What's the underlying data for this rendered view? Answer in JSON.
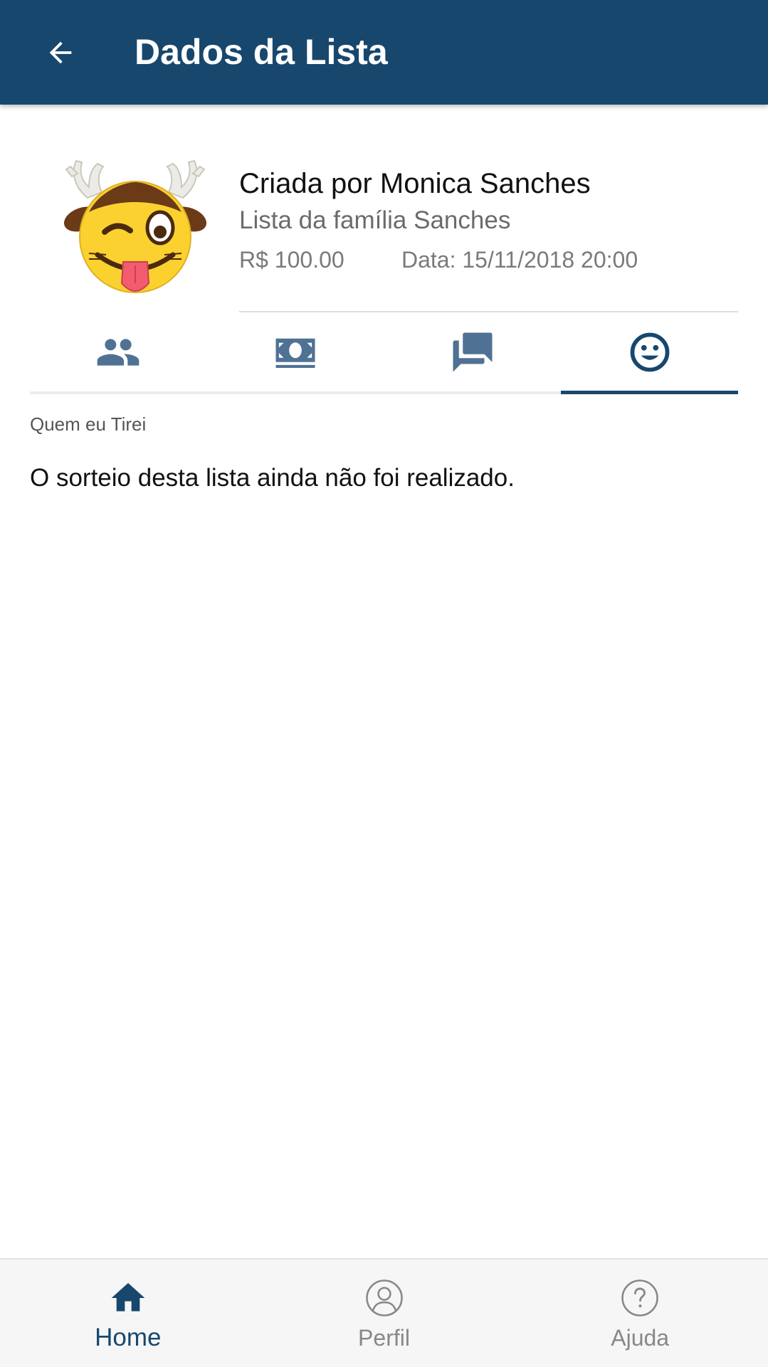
{
  "appbar": {
    "title": "Dados da Lista",
    "back_icon": "arrow-left-icon",
    "background": "#18476d"
  },
  "list_info": {
    "avatar_icon": "reindeer-emoji-icon",
    "creator": "Criada por Monica Sanches",
    "name": "Lista da família Sanches",
    "amount": "R$ 100.00",
    "date": "Data: 15/11/2018 20:00"
  },
  "tabs": [
    {
      "icon": "people-icon",
      "active": false
    },
    {
      "icon": "money-icon",
      "active": false
    },
    {
      "icon": "chat-icon",
      "active": false
    },
    {
      "icon": "smiley-icon",
      "active": true
    }
  ],
  "section": {
    "label": "Quem eu Tirei",
    "message": "O sorteio desta lista ainda não foi realizado."
  },
  "bottom_nav": [
    {
      "label": "Home",
      "icon": "home-icon",
      "active": true
    },
    {
      "label": "Perfil",
      "icon": "user-icon",
      "active": false
    },
    {
      "label": "Ajuda",
      "icon": "help-icon",
      "active": false
    }
  ],
  "colors": {
    "primary": "#18476d",
    "tab_icon_inactive": "#4f7294",
    "inactive_text": "#888888"
  }
}
